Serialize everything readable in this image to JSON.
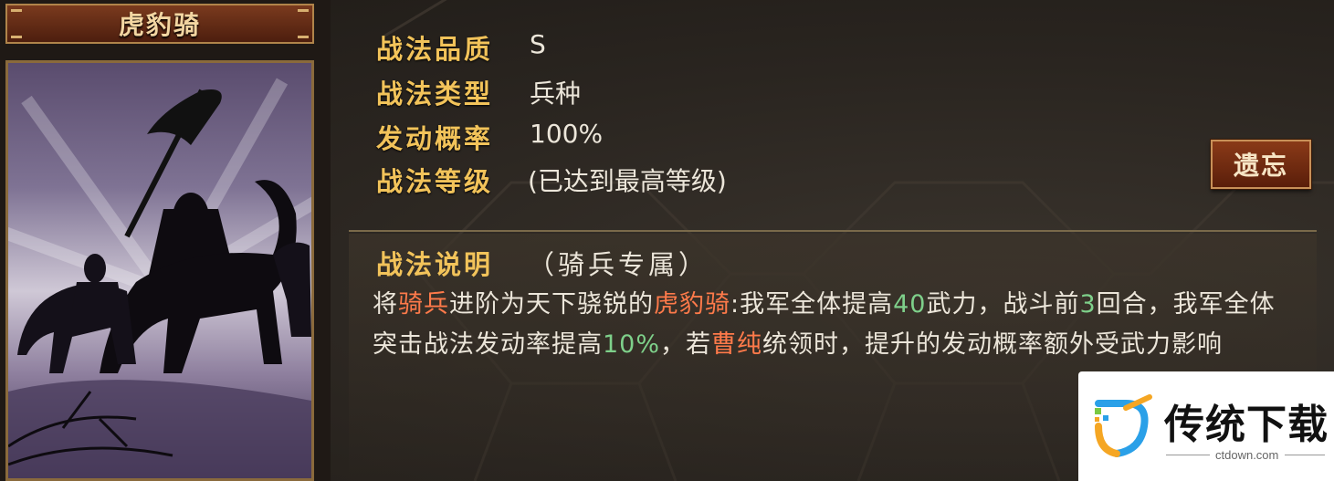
{
  "skill_name": "虎豹骑",
  "info_rows": [
    {
      "label": "战法品质",
      "value": "S"
    },
    {
      "label": "战法类型",
      "value": "兵种"
    },
    {
      "label": "发动概率",
      "value": "100%"
    },
    {
      "label": "战法等级",
      "value": "(已达到最高等级)"
    }
  ],
  "forget_button": "遗忘",
  "description": {
    "heading": "战法说明",
    "subheading": "（骑兵专属）",
    "segments": [
      {
        "text": "将",
        "style": "normal"
      },
      {
        "text": "骑兵",
        "style": "red"
      },
      {
        "text": "进阶为天下骁锐的",
        "style": "normal"
      },
      {
        "text": "虎豹骑",
        "style": "red"
      },
      {
        "text": ":我军全体提高",
        "style": "normal"
      },
      {
        "text": "40",
        "style": "green"
      },
      {
        "text": "武力，战斗前",
        "style": "normal"
      },
      {
        "text": "3",
        "style": "green"
      },
      {
        "text": "回合，我军全体突击战法发动率提高",
        "style": "normal"
      },
      {
        "text": "10%",
        "style": "green"
      },
      {
        "text": "，若",
        "style": "normal"
      },
      {
        "text": "曹纯",
        "style": "red"
      },
      {
        "text": "统领时，提升的发动概率额外受武力影响",
        "style": "normal"
      }
    ]
  },
  "watermark": {
    "title": "传统下载",
    "url": "ctdown.com"
  },
  "colors": {
    "label_gold": "#f2c35a",
    "highlight_red": "#ff7a4a",
    "highlight_green": "#7ed08a",
    "text_light": "#ece6da"
  }
}
